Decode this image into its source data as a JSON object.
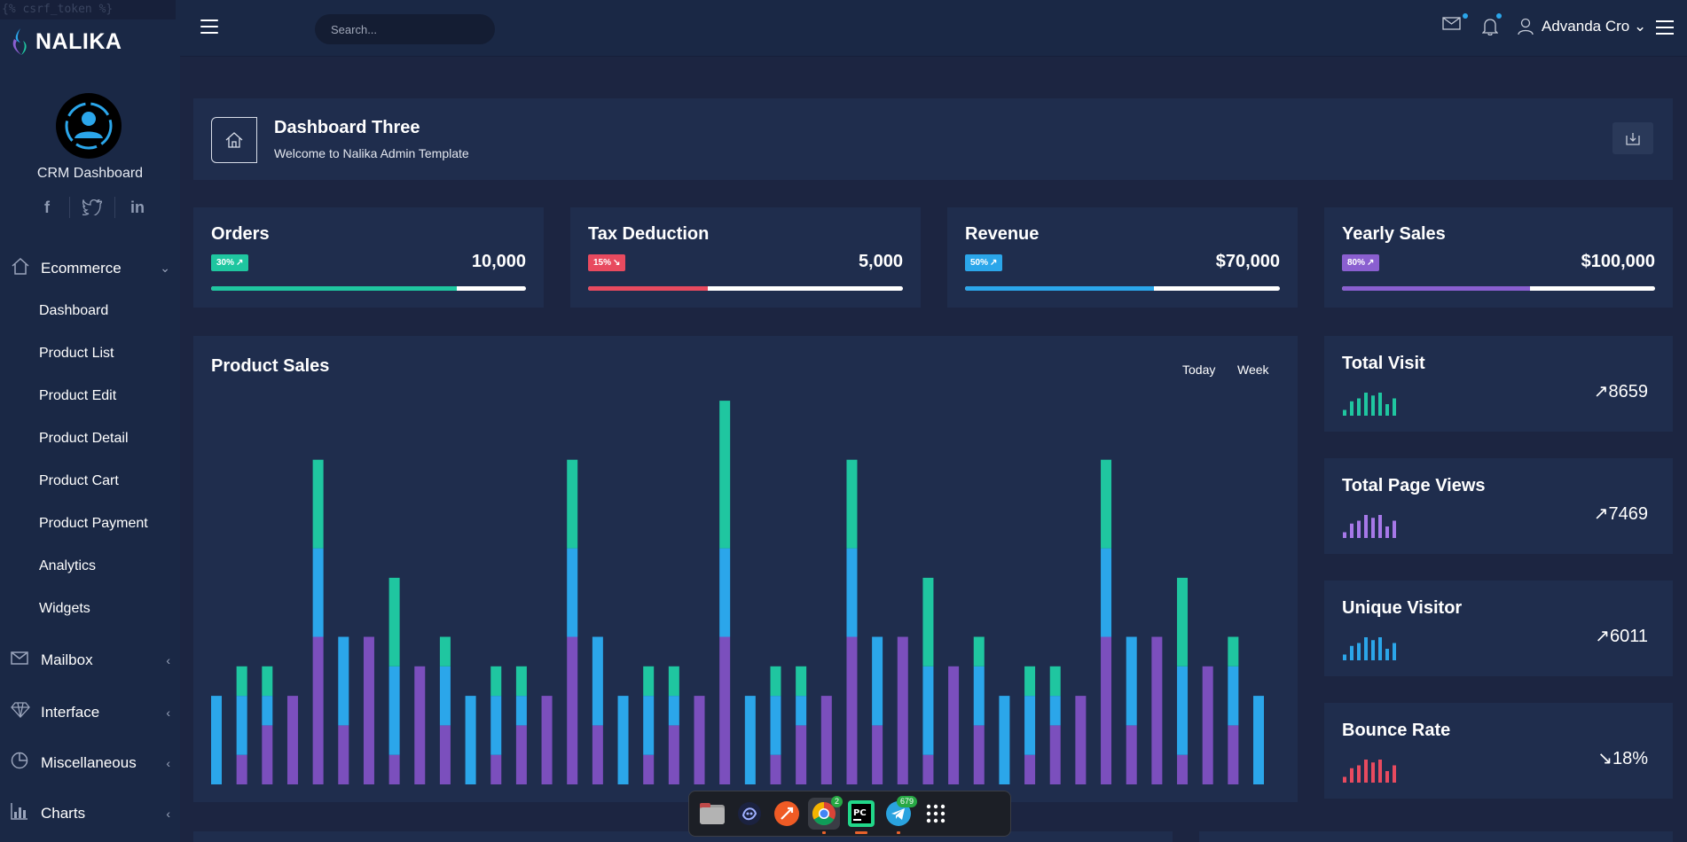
{
  "csrf_text": "{% csrf_token %}",
  "brand": {
    "name": "NALIKA"
  },
  "profile": {
    "name": "CRM Dashboard"
  },
  "socials": [
    "f",
    "twitter",
    "in"
  ],
  "nav": {
    "ecommerce": "Ecommerce",
    "sub": [
      "Dashboard",
      "Product List",
      "Product Edit",
      "Product Detail",
      "Product Cart",
      "Product Payment",
      "Analytics",
      "Widgets"
    ],
    "mailbox": "Mailbox",
    "interface": "Interface",
    "misc": "Miscellaneous",
    "charts": "Charts"
  },
  "topbar": {
    "search_placeholder": "Search...",
    "user": "Advanda Cro"
  },
  "header": {
    "title": "Dashboard Three",
    "subtitle": "Welcome to Nalika Admin Template"
  },
  "stats": [
    {
      "title": "Orders",
      "badge": "30%",
      "arrow": "↗",
      "value": "10,000",
      "percent": 78,
      "color": "#1fc6a0"
    },
    {
      "title": "Tax Deduction",
      "badge": "15%",
      "arrow": "↘",
      "value": "5,000",
      "percent": 38,
      "color": "#e84a5f"
    },
    {
      "title": "Revenue",
      "badge": "50%",
      "arrow": "↗",
      "value": "$70,000",
      "percent": 60,
      "color": "#2ba6ea"
    },
    {
      "title": "Yearly Sales",
      "badge": "80%",
      "arrow": "↗",
      "value": "$100,000",
      "percent": 60,
      "color": "#8a5fd0"
    }
  ],
  "product_sales": {
    "title": "Product Sales",
    "tabs": [
      "Today",
      "Week"
    ]
  },
  "chart_data": {
    "type": "bar",
    "stacked": true,
    "title": "Product Sales",
    "colors": {
      "purple": "#7b4fbd",
      "blue": "#2ba6ea",
      "green": "#1fc6a0"
    },
    "series": [
      {
        "values": [
          0,
          1,
          2,
          3,
          5,
          2,
          5,
          1,
          4,
          2,
          0,
          1,
          2,
          3,
          5,
          2,
          0,
          1,
          2,
          3,
          5,
          0,
          1,
          2,
          3,
          5,
          2,
          5,
          1,
          4,
          2,
          0,
          1,
          2,
          3,
          5,
          2,
          5,
          1,
          4,
          2,
          0
        ]
      },
      {
        "values": [
          3,
          2,
          1,
          0,
          3,
          3,
          0,
          3,
          0,
          2,
          3,
          2,
          1,
          0,
          3,
          3,
          3,
          2,
          1,
          0,
          3,
          3,
          2,
          1,
          0,
          3,
          3,
          0,
          3,
          0,
          2,
          3,
          2,
          1,
          0,
          3,
          3,
          0,
          3,
          0,
          2,
          3
        ]
      },
      {
        "values": [
          0,
          1,
          1,
          0,
          3,
          0,
          0,
          3,
          0,
          1,
          0,
          1,
          1,
          0,
          3,
          0,
          0,
          1,
          1,
          0,
          5,
          0,
          1,
          1,
          0,
          3,
          0,
          0,
          3,
          0,
          1,
          0,
          1,
          1,
          0,
          3,
          0,
          0,
          3,
          0,
          1,
          0
        ]
      }
    ]
  },
  "kpis": [
    {
      "title": "Total Visit",
      "arrow": "↗",
      "value": "8659",
      "color": "#1fc6a0",
      "spark": [
        2,
        5,
        6,
        8,
        7,
        8,
        4,
        6
      ]
    },
    {
      "title": "Total Page Views",
      "arrow": "↗",
      "value": "7469",
      "color": "#a678e8",
      "spark": [
        2,
        5,
        6,
        8,
        7,
        8,
        4,
        6
      ]
    },
    {
      "title": "Unique Visitor",
      "arrow": "↗",
      "value": "6011",
      "color": "#2ba6ea",
      "spark": [
        2,
        5,
        6,
        8,
        7,
        8,
        4,
        6
      ]
    },
    {
      "title": "Bounce Rate",
      "arrow": "↘",
      "value": "18%",
      "color": "#e84a5f",
      "spark": [
        2,
        5,
        6,
        8,
        7,
        8,
        4,
        6
      ]
    }
  ],
  "dock": {
    "chrome_badge": "2",
    "telegram_badge": "679"
  }
}
